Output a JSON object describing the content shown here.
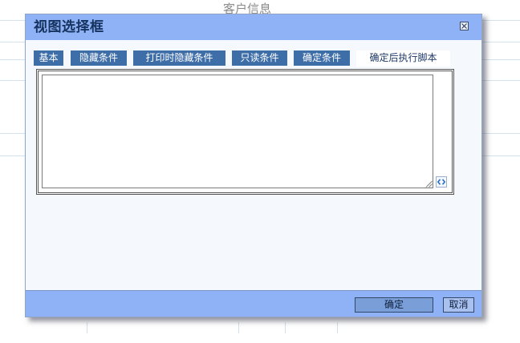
{
  "background": {
    "title": "客户信息"
  },
  "dialog": {
    "title": "视图选择框",
    "close_icon": "close-icon",
    "tabs": [
      {
        "label": "基本",
        "active": false
      },
      {
        "label": "隐藏条件",
        "active": false
      },
      {
        "label": "打印时隐藏条件",
        "active": false
      },
      {
        "label": "只读条件",
        "active": false
      },
      {
        "label": "确定条件",
        "active": false
      },
      {
        "label": "确定后执行脚本",
        "active": true
      }
    ],
    "script_editor": {
      "value": "",
      "expand_icon": "script-expand-icon"
    },
    "buttons": {
      "ok_label": "确定",
      "cancel_label": "取消"
    }
  },
  "colors": {
    "titlebar": "#8eb2f5",
    "tab": "#3e6ea8",
    "tab_active_text": "#1f3a6a",
    "body": "#f5f8fd"
  }
}
